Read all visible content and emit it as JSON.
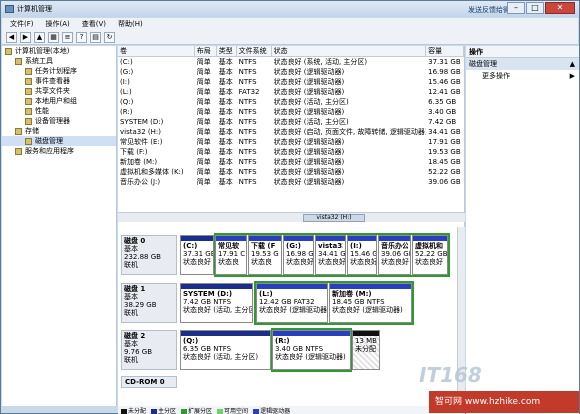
{
  "window": {
    "title": "计算机管理",
    "top_right_link": "发送反馈给微软"
  },
  "menu": [
    "文件(F)",
    "操作(A)",
    "查看(V)",
    "帮助(H)"
  ],
  "tree": [
    {
      "label": "计算机管理(本地)",
      "indent": 0
    },
    {
      "label": "系统工具",
      "indent": 1
    },
    {
      "label": "任务计划程序",
      "indent": 2
    },
    {
      "label": "事件查看器",
      "indent": 2
    },
    {
      "label": "共享文件夹",
      "indent": 2
    },
    {
      "label": "本地用户和组",
      "indent": 2
    },
    {
      "label": "性能",
      "indent": 2
    },
    {
      "label": "设备管理器",
      "indent": 2
    },
    {
      "label": "存储",
      "indent": 1
    },
    {
      "label": "磁盘管理",
      "indent": 2,
      "selected": true
    },
    {
      "label": "服务和应用程序",
      "indent": 1
    }
  ],
  "columns": [
    "卷",
    "布局",
    "类型",
    "文件系统",
    "状态",
    "容量"
  ],
  "volumes": [
    [
      "(C:)",
      "简单",
      "基本",
      "NTFS",
      "状态良好 (系统, 活动, 主分区)",
      "37.31 GB"
    ],
    [
      "(G:)",
      "简单",
      "基本",
      "NTFS",
      "状态良好 (逻辑驱动器)",
      "16.98 GB"
    ],
    [
      "(I:)",
      "简单",
      "基本",
      "NTFS",
      "状态良好 (逻辑驱动器)",
      "15.46 GB"
    ],
    [
      "(L:)",
      "简单",
      "基本",
      "FAT32",
      "状态良好 (逻辑驱动器)",
      "12.41 GB"
    ],
    [
      "(Q:)",
      "简单",
      "基本",
      "NTFS",
      "状态良好 (活动, 主分区)",
      "6.35 GB"
    ],
    [
      "(R:)",
      "简单",
      "基本",
      "NTFS",
      "状态良好 (逻辑驱动器)",
      "3.40 GB"
    ],
    [
      "SYSTEM (D:)",
      "简单",
      "基本",
      "NTFS",
      "状态良好 (活动, 主分区)",
      "7.42 GB"
    ],
    [
      "vista32 (H:)",
      "简单",
      "基本",
      "NTFS",
      "状态良好 (启动, 页面文件, 故障转储, 逻辑驱动器)",
      "34.41 GB"
    ],
    [
      "常见软件 (E:)",
      "简单",
      "基本",
      "NTFS",
      "状态良好 (逻辑驱动器)",
      "17.91 GB"
    ],
    [
      "下载 (F:)",
      "简单",
      "基本",
      "NTFS",
      "状态良好 (逻辑驱动器)",
      "19.53 GB"
    ],
    [
      "新加卷 (M:)",
      "简单",
      "基本",
      "NTFS",
      "状态良好 (逻辑驱动器)",
      "18.45 GB"
    ],
    [
      "虚拟机和多媒体 (K:)",
      "简单",
      "基本",
      "NTFS",
      "状态良好 (逻辑驱动器)",
      "52.22 GB"
    ],
    [
      "音乐办公 (J:)",
      "简单",
      "基本",
      "NTFS",
      "状态良好 (逻辑驱动器)",
      "39.06 GB"
    ]
  ],
  "hscroll_label": "vista32 (H:)",
  "disks": [
    {
      "name": "磁盘 0",
      "type": "基本",
      "size": "232.88 GB",
      "status": "联机",
      "parts": [
        {
          "l1": "(C:)",
          "l2": "37.31 GB",
          "l3": "状态良好"
        },
        {
          "l1": "常见软",
          "l2": "17.91 C",
          "l3": "状态良"
        },
        {
          "l1": "下载 (F",
          "l2": "19.53 G",
          "l3": "状态良"
        },
        {
          "l1": "(G:)",
          "l2": "16.98 G",
          "l3": "状态良好"
        },
        {
          "l1": "vista32",
          "l2": "34.41 G",
          "l3": "状态良好"
        },
        {
          "l1": "(I:)",
          "l2": "15.46 G",
          "l3": "状态良好"
        },
        {
          "l1": "音乐办公",
          "l2": "39.06 GB",
          "l3": "状态良好"
        },
        {
          "l1": "虚拟机和",
          "l2": "52.22 GB",
          "l3": "状态良好"
        }
      ]
    },
    {
      "name": "磁盘 1",
      "type": "基本",
      "size": "38.29 GB",
      "status": "联机",
      "parts": [
        {
          "l1": "SYSTEM (D:)",
          "l2": "7.42 GB NTFS",
          "l3": "状态良好 (活动, 主分区"
        },
        {
          "l1": "(L:)",
          "l2": "12.42 GB FAT32",
          "l3": "状态良好 (逻辑驱动器"
        },
        {
          "l1": "新加卷 (M:)",
          "l2": "18.45 GB NTFS",
          "l3": "状态良好 (逻辑驱动器)"
        }
      ]
    },
    {
      "name": "磁盘 2",
      "type": "基本",
      "size": "9.76 GB",
      "status": "联机",
      "parts": [
        {
          "l1": "(Q:)",
          "l2": "6.35 GB NTFS",
          "l3": "状态良好 (活动, 主分区)"
        },
        {
          "l1": "(R:)",
          "l2": "3.40 GB NTFS",
          "l3": "状态良好 (逻辑驱动器)"
        },
        {
          "l1": "",
          "l2": "13 MB",
          "l3": "未分配"
        }
      ]
    }
  ],
  "cdrom": "CD-ROM 0",
  "legend": [
    {
      "label": "未分配",
      "color": "#111111"
    },
    {
      "label": "主分区",
      "color": "#1b2e8c"
    },
    {
      "label": "扩展分区",
      "color": "#2f9a2f"
    },
    {
      "label": "可用空间",
      "color": "#6cd46c"
    },
    {
      "label": "逻辑驱动器",
      "color": "#2a3fc0"
    }
  ],
  "actions": {
    "header": "操作",
    "section": "磁盘管理",
    "more": "更多操作"
  },
  "watermark": "智可网 www.hzhike.com",
  "logo_text": "IT168"
}
